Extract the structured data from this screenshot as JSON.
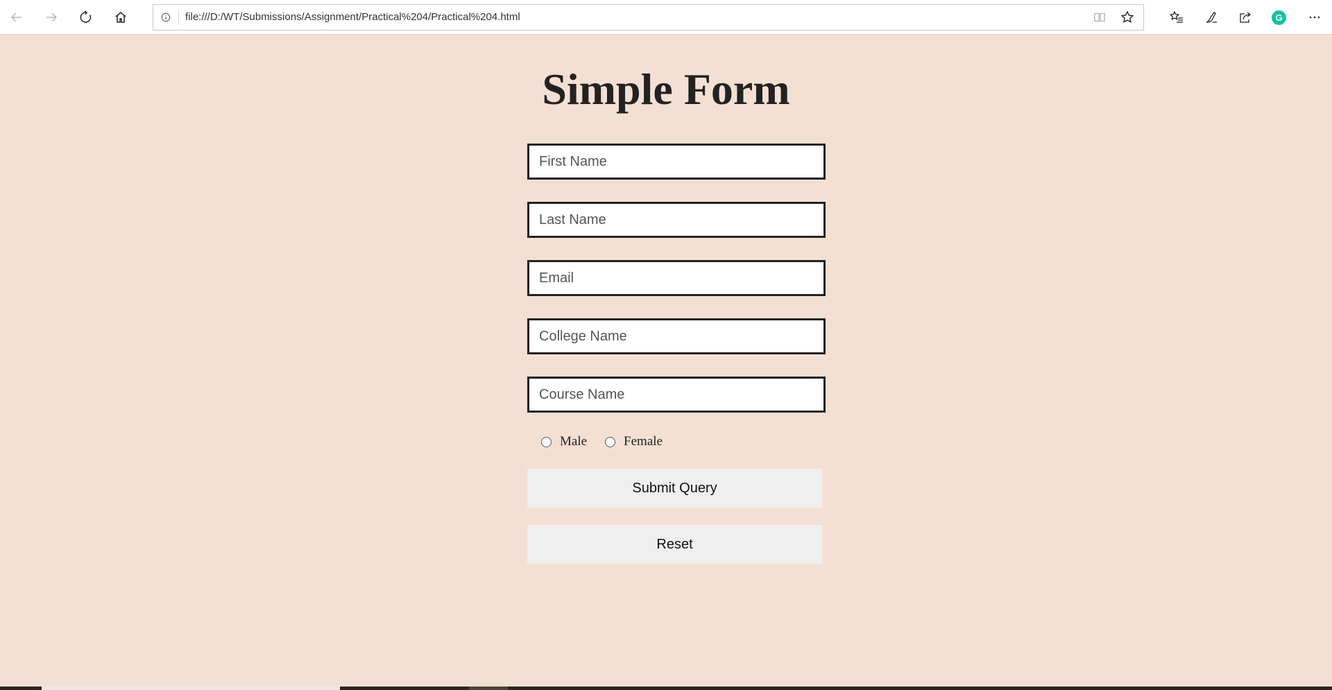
{
  "browser": {
    "address_url": "file:///D:/WT/Submissions/Assignment/Practical%204/Practical%204.html",
    "grammarly_letter": "G"
  },
  "icons": {
    "back": "back-arrow-icon",
    "forward": "forward-arrow-icon",
    "refresh": "refresh-icon",
    "home": "home-icon",
    "info": "info-icon",
    "reading_view": "reading-view-icon",
    "favorite": "star-icon",
    "favorites_list": "favorites-list-icon",
    "pen": "pen-icon",
    "share": "share-icon",
    "grammarly": "grammarly-icon",
    "more": "more-icon"
  },
  "form": {
    "title": "Simple Form",
    "fields": {
      "first_name": "First Name",
      "last_name": "Last Name",
      "email": "Email",
      "college_name": "College Name",
      "course_name": "Course Name"
    },
    "gender": {
      "male": "Male",
      "female": "Female"
    },
    "submit_label": "Submit Query",
    "reset_label": "Reset"
  },
  "colors": {
    "page_background": "#f4e0d3",
    "field_border": "#222222",
    "button_background": "#efefef",
    "grammarly": "#15c39a"
  }
}
